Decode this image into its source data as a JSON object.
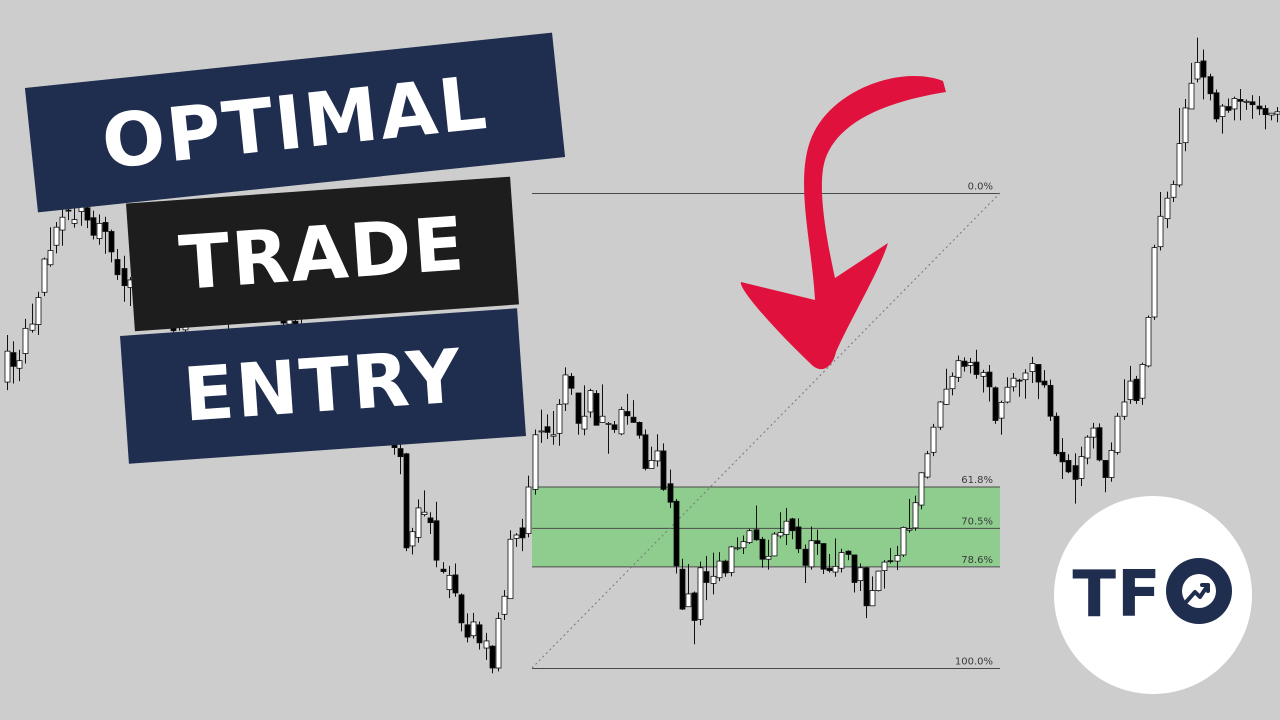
{
  "title_lines": [
    "OPTIMAL",
    "TRADE",
    "ENTRY"
  ],
  "logo": {
    "text": "TF",
    "icon": "trend-up-circle-icon"
  },
  "colors": {
    "background": "#cdcdcd",
    "title_navy": "#1f2d4f",
    "title_black": "#1d1d1d",
    "zone_fill": "#8fcd8f",
    "arrow": "#e0123d",
    "bull_candle": "#ffffff",
    "bear_candle": "#000000"
  },
  "chart_data": {
    "type": "candlestick",
    "title": "",
    "xlabel": "",
    "ylabel": "",
    "ylim": [
      100,
      0
    ],
    "fib_levels": [
      {
        "label": "0.0%",
        "value": 0
      },
      {
        "label": "61.8%",
        "value": 61.8
      },
      {
        "label": "70.5%",
        "value": 70.5
      },
      {
        "label": "78.6%",
        "value": 78.6
      },
      {
        "label": "100.0%",
        "value": 100
      }
    ],
    "ote_zone": [
      61.8,
      78.6
    ],
    "candles": [
      [
        60.2,
        66.7,
        70.1,
        58.5
      ],
      [
        66.4,
        63.5,
        68.8,
        59.9
      ],
      [
        63.1,
        64.7,
        67.0,
        60.4
      ],
      [
        66.2,
        71.5,
        73.5,
        64.1
      ],
      [
        71.1,
        72.4,
        76.7,
        70.6
      ],
      [
        72.3,
        78.0,
        79.2,
        70.1
      ],
      [
        79.1,
        86.1,
        86.4,
        78.3
      ],
      [
        84.9,
        87.9,
        92.8,
        84.5
      ],
      [
        89.0,
        92.8,
        93.9,
        87.3
      ],
      [
        92.2,
        94.9,
        96.8,
        88.9
      ],
      [
        96.4,
        96.3,
        98.5,
        94.3
      ],
      [
        93.6,
        94.4,
        97.3,
        92.7
      ],
      [
        96.1,
        97.8,
        101.4,
        93.1
      ],
      [
        96.9,
        94.3,
        98.8,
        92.6
      ],
      [
        94.8,
        91.1,
        96.3,
        90.2
      ],
      [
        90.4,
        93.6,
        95.5,
        89.1
      ],
      [
        93.8,
        91.9,
        95.0,
        87.2
      ],
      [
        91.9,
        87.6,
        92.3,
        85.4
      ],
      [
        86.0,
        82.8,
        88.2,
        81.7
      ],
      [
        84.1,
        80.5,
        86.8,
        77.1
      ],
      [
        80.1,
        81.7,
        82.3,
        76.2
      ],
      [
        82.4,
        77.4,
        82.9,
        76.2
      ],
      [
        79.2,
        77.0,
        84.1,
        74.7
      ],
      [
        76.9,
        77.6,
        80.4,
        74.2
      ],
      [
        79.6,
        76.8,
        81.5,
        76.1
      ],
      [
        77.0,
        73.6,
        78.3,
        72.5
      ],
      [
        74.3,
        75.4,
        78.1,
        73.0
      ],
      [
        75.9,
        71.0,
        76.7,
        68.3
      ],
      [
        71.9,
        71.8,
        74.0,
        71.0
      ],
      [
        71.2,
        76.7,
        77.5,
        69.6
      ],
      [
        77.5,
        79.0,
        82.6,
        77.1
      ],
      [
        79.4,
        81.6,
        82.2,
        79.2
      ],
      [
        81.3,
        80.5,
        85.4,
        79.1
      ],
      [
        80.3,
        77.1,
        81.0,
        73.9
      ],
      [
        77.7,
        77.5,
        81.1,
        74.8
      ],
      [
        77.5,
        72.6,
        80.6,
        72.3
      ],
      [
        72.8,
        73.3,
        76.4,
        69.2
      ],
      [
        73.8,
        76.1,
        80.9,
        73.4
      ],
      [
        76.1,
        80.2,
        81.1,
        75.7
      ],
      [
        79.0,
        81.9,
        85.4,
        78.7
      ],
      [
        81.5,
        83.3,
        85.9,
        80.4
      ],
      [
        83.5,
        83.6,
        86.9,
        80.5
      ],
      [
        83.3,
        80.1,
        84.2,
        76.0
      ],
      [
        81.4,
        78.4,
        84.5,
        75.4
      ],
      [
        78.7,
        76.9,
        79.8,
        73.9
      ],
      [
        76.6,
        72.6,
        77.0,
        71.3
      ],
      [
        72.4,
        73.9,
        78.1,
        71.1
      ],
      [
        73.0,
        70.3,
        74.5,
        68.4
      ],
      [
        70.2,
        69.6,
        74.8,
        67.1
      ],
      [
        69.7,
        70.1,
        71.0,
        64.5
      ],
      [
        69.4,
        66.8,
        71.1,
        65.4
      ],
      [
        66.7,
        63.5,
        68.8,
        60.0
      ],
      [
        64.2,
        61.9,
        64.8,
        57.9
      ],
      [
        61.1,
        62.2,
        64.6,
        58.2
      ],
      [
        62.8,
        64.1,
        64.9,
        56.4
      ],
      [
        64.0,
        57.3,
        65.1,
        54.4
      ],
      [
        56.6,
        54.8,
        60.1,
        52.1
      ],
      [
        53.8,
        56.9,
        58.1,
        51.8
      ],
      [
        57.6,
        61.5,
        63.3,
        56.8
      ],
      [
        61.2,
        62.0,
        65.5,
        58.9
      ],
      [
        61.8,
        65.1,
        67.0,
        61.8
      ],
      [
        63.8,
        57.8,
        64.1,
        57.5
      ],
      [
        58.3,
        50.7,
        60.5,
        47.9
      ],
      [
        50.5,
        46.4,
        51.4,
        44.9
      ],
      [
        46.2,
        44.5,
        47.2,
        40.8
      ],
      [
        45.1,
        25.3,
        45.3,
        24.6
      ],
      [
        25.7,
        28.7,
        29.5,
        23.9
      ],
      [
        27.5,
        33.7,
        35.5,
        26.4
      ],
      [
        32.3,
        32.8,
        37.4,
        31.9
      ],
      [
        31.6,
        30.6,
        32.8,
        28.2
      ],
      [
        31.0,
        22.7,
        35.0,
        21.2
      ],
      [
        20.8,
        20.3,
        22.3,
        19.9
      ],
      [
        16.5,
        19.5,
        21.5,
        14.7
      ],
      [
        19.6,
        15.8,
        22.0,
        15.0
      ],
      [
        15.4,
        9.5,
        15.7,
        7.7
      ],
      [
        9.1,
        6.5,
        11.5,
        5.4
      ],
      [
        6.8,
        9.7,
        11.6,
        6.2
      ],
      [
        9.1,
        5.3,
        9.8,
        3.9
      ],
      [
        4.2,
        5.7,
        7.4,
        1.7
      ],
      [
        4.6,
        0.0,
        4.8,
        -1.1
      ],
      [
        0.0,
        10.4,
        11.7,
        -0.7
      ],
      [
        11.3,
        15.1,
        16.4,
        10.1
      ],
      [
        14.6,
        27.1,
        29.0,
        14.6
      ],
      [
        27.3,
        28.0,
        28.4,
        25.5
      ],
      [
        29.5,
        27.4,
        31.4,
        24.6
      ],
      [
        28.3,
        38.1,
        40.5,
        27.5
      ],
      [
        37.6,
        49.1,
        50.2,
        36.5
      ],
      [
        49.8,
        49.9,
        54.4,
        47.4
      ],
      [
        50.8,
        49.6,
        53.4,
        48.2
      ],
      [
        48.8,
        49.1,
        54.1,
        47.0
      ],
      [
        49.4,
        55.5,
        56.6,
        46.8
      ],
      [
        55.6,
        61.7,
        63.3,
        54.1
      ],
      [
        61.4,
        58.9,
        62.1,
        57.5
      ],
      [
        57.9,
        51.5,
        57.9,
        49.1
      ],
      [
        50.3,
        53.0,
        59.5,
        49.0
      ],
      [
        53.9,
        58.4,
        58.8,
        52.7
      ],
      [
        57.8,
        51.1,
        58.5,
        51.1
      ],
      [
        51.7,
        53.0,
        59.7,
        51.7
      ],
      [
        51.5,
        51.5,
        51.8,
        45.1
      ],
      [
        51.2,
        50.2,
        52.0,
        49.5
      ],
      [
        49.3,
        54.4,
        55.0,
        49.0
      ],
      [
        54.0,
        53.1,
        57.7,
        51.2
      ],
      [
        52.8,
        51.7,
        56.4,
        51.6
      ],
      [
        51.7,
        49.0,
        51.9,
        48.3
      ],
      [
        49.1,
        42.0,
        50.2,
        41.6
      ],
      [
        42.0,
        43.7,
        46.6,
        42.3
      ],
      [
        43.6,
        45.7,
        49.2,
        42.4
      ],
      [
        45.7,
        37.6,
        47.3,
        37.3
      ],
      [
        38.8,
        34.9,
        41.8,
        33.7
      ],
      [
        35.1,
        21.5,
        35.6,
        19.9
      ],
      [
        20.8,
        12.4,
        23.0,
        12.2
      ],
      [
        12.9,
        15.6,
        21.9,
        12.9
      ],
      [
        15.8,
        10.0,
        16.1,
        5.0
      ],
      [
        10.2,
        21.1,
        22.4,
        9.0
      ],
      [
        20.3,
        18.0,
        23.6,
        14.3
      ],
      [
        17.8,
        19.3,
        24.3,
        15.5
      ],
      [
        19.0,
        22.5,
        24.4,
        18.3
      ],
      [
        22.5,
        20.0,
        22.8,
        19.2
      ],
      [
        20.1,
        25.5,
        25.7,
        19.3
      ],
      [
        25.2,
        25.3,
        27.5,
        24.8
      ],
      [
        25.3,
        26.6,
        27.9,
        24.0
      ],
      [
        26.4,
        28.9,
        29.3,
        26.1
      ],
      [
        29.1,
        27.0,
        34.2,
        26.8
      ],
      [
        27.1,
        22.9,
        27.6,
        21.1
      ],
      [
        22.9,
        23.5,
        27.0,
        20.7
      ],
      [
        23.6,
        28.2,
        28.6,
        23.5
      ],
      [
        27.8,
        28.5,
        32.8,
        27.3
      ],
      [
        28.1,
        30.9,
        33.7,
        25.9
      ],
      [
        31.4,
        28.9,
        31.6,
        27.1
      ],
      [
        29.7,
        25.1,
        31.5,
        24.2
      ],
      [
        25.0,
        21.6,
        26.0,
        17.9
      ],
      [
        21.3,
        26.8,
        29.8,
        20.7
      ],
      [
        26.8,
        26.2,
        29.1,
        23.8
      ],
      [
        26.2,
        20.8,
        26.3,
        19.8
      ],
      [
        21.0,
        20.5,
        24.0,
        20.1
      ],
      [
        20.2,
        21.4,
        27.3,
        19.2
      ],
      [
        21.0,
        24.3,
        25.1,
        20.1
      ],
      [
        24.6,
        23.9,
        24.8,
        22.7
      ],
      [
        23.8,
        18.0,
        23.9,
        15.9
      ],
      [
        18.4,
        21.1,
        22.0,
        16.2
      ],
      [
        21.1,
        13.1,
        21.3,
        10.5
      ],
      [
        13.1,
        16.3,
        19.3,
        13.1
      ],
      [
        16.3,
        20.4,
        20.5,
        16.1
      ],
      [
        20.5,
        22.3,
        22.7,
        16.7
      ],
      [
        22.6,
        22.4,
        25.3,
        22.0
      ],
      [
        22.5,
        23.7,
        25.7,
        20.6
      ],
      [
        23.8,
        29.6,
        29.8,
        23.4
      ],
      [
        29.0,
        29.3,
        35.6,
        28.5
      ],
      [
        29.5,
        34.8,
        36.3,
        28.9
      ],
      [
        34.3,
        41.1,
        41.2,
        33.4
      ],
      [
        40.2,
        45.1,
        45.7,
        39.9
      ],
      [
        45.4,
        50.7,
        51.4,
        44.6
      ],
      [
        50.7,
        56.0,
        56.2,
        50.1
      ],
      [
        55.5,
        58.7,
        63.0,
        55.4
      ],
      [
        58.8,
        61.4,
        62.2,
        57.4
      ],
      [
        61.2,
        64.7,
        65.8,
        60.2
      ],
      [
        64.6,
        63.5,
        65.4,
        62.4
      ],
      [
        63.7,
        64.3,
        65.3,
        62.0
      ],
      [
        64.4,
        61.8,
        67.0,
        60.9
      ],
      [
        61.4,
        62.2,
        62.8,
        58.0
      ],
      [
        62.3,
        59.2,
        63.8,
        56.1
      ],
      [
        59.0,
        52.1,
        59.3,
        51.4
      ],
      [
        52.6,
        55.9,
        56.3,
        49.1
      ],
      [
        56.0,
        59.1,
        61.2,
        55.7
      ],
      [
        59.2,
        61.0,
        62.1,
        58.2
      ],
      [
        60.6,
        60.4,
        60.9,
        57.1
      ],
      [
        60.7,
        62.1,
        62.9,
        56.7
      ],
      [
        62.4,
        64.1,
        65.5,
        60.0
      ],
      [
        63.9,
        60.2,
        63.9,
        56.6
      ],
      [
        60.4,
        59.6,
        62.7,
        59.0
      ],
      [
        59.5,
        53.0,
        60.7,
        52.0
      ],
      [
        53.0,
        45.1,
        53.8,
        44.6
      ],
      [
        45.4,
        43.4,
        48.4,
        39.8
      ],
      [
        43.7,
        41.3,
        45.0,
        41.0
      ],
      [
        42.6,
        39.7,
        45.2,
        34.6
      ],
      [
        39.9,
        44.5,
        46.6,
        38.3
      ],
      [
        44.2,
        48.6,
        49.0,
        42.9
      ],
      [
        48.6,
        50.5,
        51.6,
        46.2
      ],
      [
        50.6,
        43.8,
        51.5,
        43.5
      ],
      [
        43.7,
        40.1,
        43.7,
        37.0
      ],
      [
        40.1,
        45.8,
        47.5,
        39.2
      ],
      [
        45.4,
        53.0,
        53.7,
        44.9
      ],
      [
        53.0,
        56.0,
        60.8,
        52.2
      ],
      [
        56.5,
        60.4,
        63.6,
        55.6
      ],
      [
        60.8,
        56.3,
        61.5,
        55.6
      ],
      [
        56.8,
        63.9,
        64.3,
        55.4
      ],
      [
        63.6,
        73.8,
        74.2,
        63.3
      ],
      [
        73.9,
        88.5,
        89.1,
        73.3
      ],
      [
        88.7,
        95.1,
        100.2,
        87.9
      ],
      [
        94.6,
        98.9,
        100.3,
        92.6
      ],
      [
        99.1,
        101.8,
        102.6,
        98.1
      ],
      [
        101.7,
        110.4,
        117.9,
        101.2
      ],
      [
        110.6,
        117.9,
        119.8,
        108.8
      ],
      [
        117.7,
        123.1,
        127.4,
        117.8
      ],
      [
        124.0,
        127.5,
        132.7,
        123.3
      ],
      [
        127.8,
        124.4,
        130.2,
        119.7
      ],
      [
        124.5,
        120.9,
        125.1,
        119.5
      ],
      [
        121.1,
        115.6,
        121.8,
        114.9
      ],
      [
        116.1,
        118.3,
        118.7,
        112.5
      ],
      [
        118.2,
        117.4,
        119.9,
        116.9
      ],
      [
        117.7,
        119.9,
        120.3,
        115.3
      ],
      [
        119.7,
        119.3,
        121.9,
        115.3
      ],
      [
        119.2,
        119.3,
        119.7,
        117.5
      ],
      [
        119.2,
        118.6,
        120.6,
        115.6
      ],
      [
        118.3,
        117.7,
        120.4,
        116.4
      ],
      [
        117.8,
        116.5,
        118.5,
        113.4
      ],
      [
        116.4,
        116.8,
        116.8,
        115.3
      ],
      [
        116.6,
        117.1,
        118.1,
        114.9
      ]
    ]
  }
}
